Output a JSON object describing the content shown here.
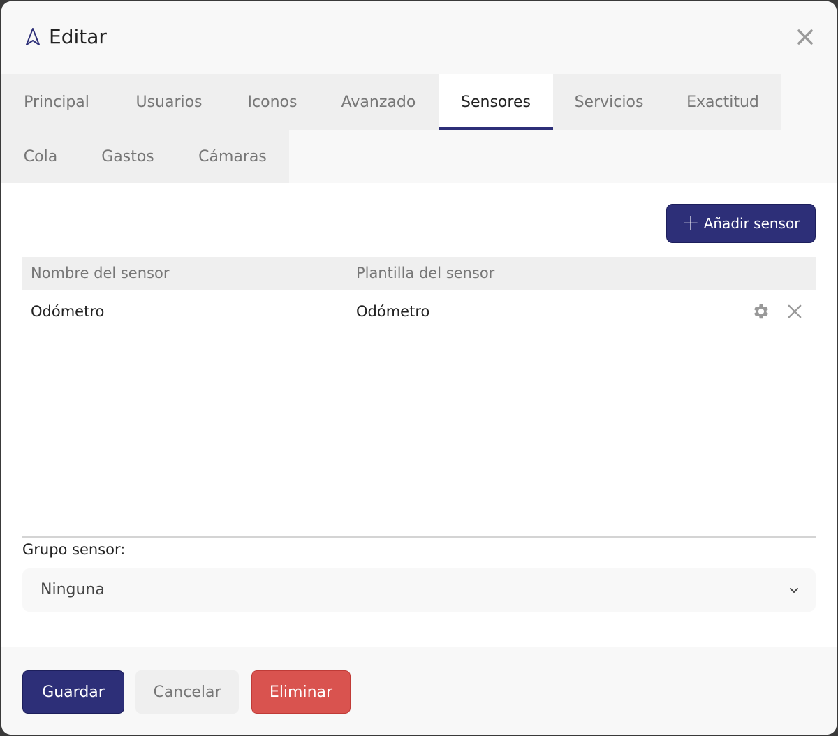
{
  "modal": {
    "title": "Editar",
    "icon": "navigation-arrow-icon",
    "close_icon": "close-icon"
  },
  "tabs": [
    {
      "label": "Principal",
      "active": false
    },
    {
      "label": "Usuarios",
      "active": false
    },
    {
      "label": "Iconos",
      "active": false
    },
    {
      "label": "Avanzado",
      "active": false
    },
    {
      "label": "Sensores",
      "active": true
    },
    {
      "label": "Servicios",
      "active": false
    },
    {
      "label": "Exactitud",
      "active": false
    },
    {
      "label": "Cola",
      "active": false
    },
    {
      "label": "Gastos",
      "active": false
    },
    {
      "label": "Cámaras",
      "active": false
    }
  ],
  "sensors": {
    "add_button_label": "Añadir sensor",
    "columns": [
      "Nombre del sensor",
      "Plantilla del sensor"
    ],
    "rows": [
      {
        "name": "Odómetro",
        "template": "Odómetro",
        "actions": [
          "gear-icon",
          "close-icon"
        ]
      }
    ]
  },
  "group": {
    "label": "Grupo sensor:",
    "selected": "Ninguna"
  },
  "footer": {
    "save_label": "Guardar",
    "cancel_label": "Cancelar",
    "delete_label": "Eliminar"
  },
  "colors": {
    "primary": "#2d2f78",
    "danger": "#d9534f",
    "tab_bg": "#efefef",
    "header_bg": "#f8f8f8"
  }
}
